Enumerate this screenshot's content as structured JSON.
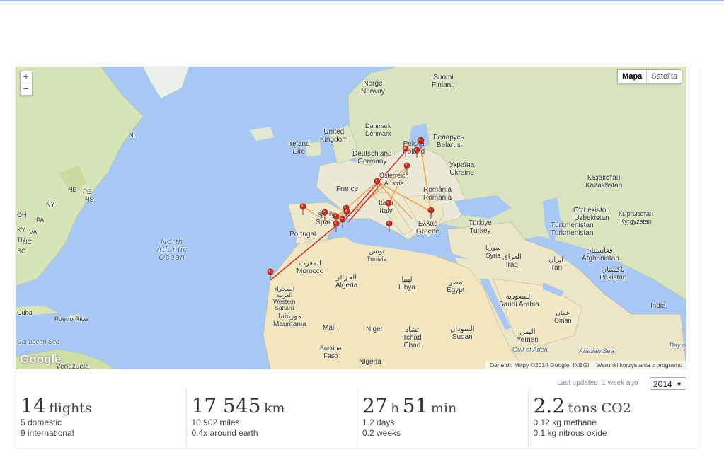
{
  "map": {
    "zoom_in": "+",
    "zoom_out": "−",
    "map_type_map": "Mapa",
    "map_type_satellite": "Satelita",
    "logo": "Google",
    "attribution": "Dane do Mapy ©2014 Google, INEGI",
    "terms": "Warunki korzystania z programu",
    "labels": {
      "suomi": "Suomi\nFinland",
      "norge": "Norge\nNorway",
      "danmark": "Danmark\nDenmark",
      "uk": "United\nKingdom",
      "ireland": "Ireland\nÉire",
      "deutschland": "Deutschland\nGermany",
      "polska": "Polska\nPoland",
      "belarus": "Беларусь\nBelarus",
      "ukraine": "Україна\nUkraine",
      "kazakhstan": "Казакстан\nKazakhstan",
      "france": "France",
      "austria": "Österreich\nAustria",
      "romania": "România\nRomania",
      "espana": "España\nSpain",
      "portugal": "Portugal",
      "italia": "Italia\nItaly",
      "greece": "Ελλάς\nGreece",
      "turkey": "Türkiye\nTurkey",
      "uzbekistan": "O'zbekiston\nUzbekistan",
      "kyrgyzstan": "Кыргызстан\nKyrgyzstan",
      "turkmenistan": "Türkmenistan\nTurkmenistan",
      "syria": "سوريا\nSyria",
      "iraq": "العراق\nIraq",
      "iran": "ایران\nIran",
      "afghanistan": "افغانستان\nAfghanistan",
      "pakistan": "پاکستان\nPakistan",
      "india": "India",
      "tunisia": "تونس\nTunisia",
      "morocco": "المغرب\nMorocco",
      "algeria": "الجزائر\nAlgeria",
      "libya": "ليبيا\nLibya",
      "egypt": "مصر\nEgypt",
      "saudi": "السعودية\nSaudi Arabia",
      "oman": "عمان\nOman",
      "yemen": "اليمن\nYemen",
      "western_sahara": "الصحراء\nالغربية\nWestern\nSahara",
      "mauritania": "موريتانيا\nMauritania",
      "mali": "Mali",
      "niger": "Niger",
      "chad": "تشاد\nTchad\nChad",
      "sudan": "السودان\nSudan",
      "burkina": "Burkina\nFaso",
      "nigeria": "Nigeria",
      "north_atlantic": "North\nAtlantic\nOcean",
      "puerto_rico": "Puerto Rico",
      "cuba": "Cuba",
      "caribbean": "Caribbean Sea",
      "venezuela": "Venezuela",
      "gulf_aden": "Gulf of Aden",
      "arabian_sea": "Arabian Sea",
      "bay": "Bay o",
      "nl": "NL",
      "pe": "PE",
      "nb": "NB",
      "ns": "NS",
      "ny": "NY",
      "pa": "PA",
      "va": "VA",
      "nc": "NC",
      "oh": "OH",
      "ky": "KY",
      "tn": "TN",
      "sc": "SC"
    }
  },
  "last_updated": "Last updated: 1 week ago",
  "year_select": {
    "value": "2014",
    "arrow": "▼"
  },
  "stats": [
    {
      "number": "14",
      "unit": "flights",
      "line1": "5 domestic",
      "line2": "9 international"
    },
    {
      "number": "17 545",
      "unit": "km",
      "line1": "10 902 miles",
      "line2": "0.4x around earth"
    },
    {
      "number": "27",
      "unit": "h",
      "number2": "51",
      "unit2": "min",
      "line1": "1.2 days",
      "line2": "0.2 weeks"
    },
    {
      "number": "2.2",
      "unit": "tons CO2",
      "line1": "0.12 kg methane",
      "line2": "0.1 kg nitrous oxide"
    }
  ],
  "colors": {
    "sea": "#a7c8f2",
    "land": "#eae6d6",
    "flight_red": "#c33333",
    "flight_orange": "#f0a640",
    "pin": "#d42b20"
  }
}
